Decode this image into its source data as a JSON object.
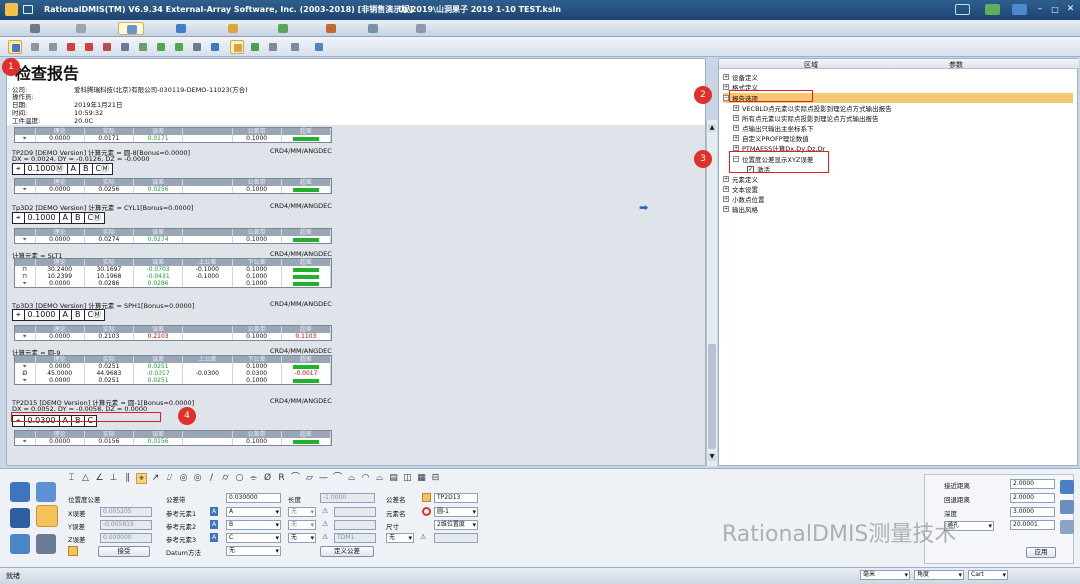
{
  "window": {
    "title": "RationalDMIS(TM) V6.9.34   External-Array Software, Inc. (2003-2018) [非销售演示版]",
    "path": "D:\\2019\\山洞果子 2019 1-10 TEST.ksln"
  },
  "report": {
    "title": "检查报告",
    "header": [
      {
        "label": "公司:",
        "value": "爱科腾瑞科技(北京)有限公司-030119-DEMO-11023(方合)"
      },
      {
        "label": "操作员:",
        "value": ""
      },
      {
        "label": "日期:",
        "value": "2019年1月21日"
      },
      {
        "label": "时间:",
        "value": "10:59:32"
      },
      {
        "label": "工件温度:",
        "value": "20.0C"
      }
    ],
    "cols_basic": [
      "理论",
      "实际",
      "误差",
      "公差带",
      "超差"
    ],
    "cols_ext": [
      "理论",
      "实际",
      "误差",
      "上公差",
      "下公差",
      "超差"
    ],
    "rows": [
      {
        "vals": [
          "0.0000",
          "0.0171",
          "0.0171",
          "0.1000",
          ""
        ],
        "status": "ok"
      },
      {
        "feature": "TP2D9   [DEMO Version]  计算元素 = 圆-8[Bonus=0.0000]",
        "crd": "CRD4/MM/ANGDEC",
        "dev": "DX = 0.0024, DY = -0.0126, DZ = -0.0000",
        "fcf": [
          "⌖",
          "0.1000Ⓜ",
          "A",
          "B",
          "CⓂ"
        ],
        "vals": [
          "0.0000",
          "0.0256",
          "0.0256",
          "0.1000",
          ""
        ]
      },
      {
        "feature": "Tp3D2   [DEMO Version]  计算元素 = CYL1[Bonus=0.0000]",
        "crd": "CRD4/MM/ANGDEC",
        "fcf": [
          "⌖",
          "0.1000",
          "A",
          "B",
          "CⓂ"
        ],
        "vals": [
          "0.0000",
          "0.0274",
          "0.0274",
          "0.1000",
          ""
        ]
      },
      {
        "feature": "计算元素 = SLT1",
        "crd": "CRD4/MM/ANGDEC",
        "ext": [
          [
            "30.2400",
            "30.1697",
            "-0.0703",
            "-0.1000",
            "0.1000"
          ],
          [
            "10.2399",
            "10.1968",
            "-0.0431",
            "-0.1000",
            "0.1000"
          ],
          [
            "0.0000",
            "0.0286",
            "0.0286",
            "",
            "0.1000"
          ]
        ]
      },
      {
        "feature": "Tp3D3   [DEMO Version]  计算元素 = SPH1[Bonus=0.0000]",
        "crd": "CRD4/MM/ANGDEC",
        "fcf": [
          "⌖",
          "0.1000",
          "A",
          "B",
          "CⓂ"
        ],
        "vals": [
          "0.0000",
          "0.2103",
          "0.2103",
          "0.1000",
          "0.1103"
        ]
      },
      {
        "feature": "计算元素 = 圆-9",
        "crd": "CRD4/MM/ANGDEC",
        "ext": [
          [
            "0.0000",
            "0.0251",
            "0.0251",
            "",
            "0.1000"
          ],
          [
            "45.0000",
            "44.9683",
            "-0.0317",
            "-0.0300",
            "0.0300",
            "-0.0017"
          ],
          [
            "0.0000",
            "0.0251",
            "0.0251",
            "",
            "0.1000"
          ]
        ]
      },
      {
        "feature": "TP2D15   [DEMO Version]  计算元素 = 圆-1[Bonus=0.0000]",
        "crd": "CRD4/MM/ANGDEC",
        "dev": "DX = 0.0052, DY = -0.0058, DZ = 0.0000",
        "fcf": [
          "⌖",
          "0.0300",
          "A",
          "B",
          "C"
        ],
        "vals": [
          "0.0000",
          "0.0156",
          "0.0156",
          "0.1000",
          ""
        ]
      }
    ]
  },
  "tree": {
    "col_region": "区域",
    "col_param": "参数",
    "items": [
      "设备定义",
      "格式定义",
      "报告选项",
      "VECBLD点元素以实际点投影到理论点方式输出报告",
      "所有点元素以实际点投影到理论点方式输出报告",
      "点输出只输出主坐标系下",
      "自定义PROFP理论数值",
      "PTMAESS计算Dx,Dy,Dz,Dr",
      "位置度公差显示XYZ误差",
      "激活",
      "元素定义",
      "文本设置",
      "小数点位置",
      "输出风格"
    ]
  },
  "badges": [
    "1",
    "2",
    "3",
    "4"
  ],
  "bottom": {
    "pos_tol_label": "位置度公差",
    "x_err": {
      "label": "X误差",
      "value": "0.005205"
    },
    "y_err": {
      "label": "Y误差",
      "value": "-0.005819"
    },
    "z_err": {
      "label": "Z误差",
      "value": "0.000000"
    },
    "accept": "接受",
    "tolband": {
      "label": "公差带",
      "value": "0.030000"
    },
    "ref1": {
      "label": "参考元素1",
      "value": "A"
    },
    "ref2": {
      "label": "参考元素2",
      "value": "B"
    },
    "ref3": {
      "label": "参考元素3",
      "value": "C"
    },
    "datum": {
      "label": "Datum方法",
      "value": "无"
    },
    "length": {
      "label": "长度",
      "value": "-1.0000"
    },
    "none": "无",
    "tdm": "TDM1",
    "define_tol": "定义公差",
    "tol_name": {
      "label": "公差名",
      "value": "TP2D13"
    },
    "feat_name": {
      "label": "元素名",
      "value": "圆-1"
    },
    "size": {
      "label": "尺寸",
      "value": "2维位置度"
    },
    "approach": {
      "label": "接近距离",
      "value": "2.0000"
    },
    "retract": {
      "label": "回退距离",
      "value": "2.0000"
    },
    "depth": {
      "label": "深度",
      "value": "3.0000"
    },
    "hole": {
      "value": "通孔"
    },
    "hole_val": "20.0001",
    "apply": "应用",
    "watermark": "RationalDMIS测量技术"
  },
  "status": {
    "left": "就绪",
    "unit": "毫米",
    "angle": "角度",
    "coord": "Cart"
  }
}
